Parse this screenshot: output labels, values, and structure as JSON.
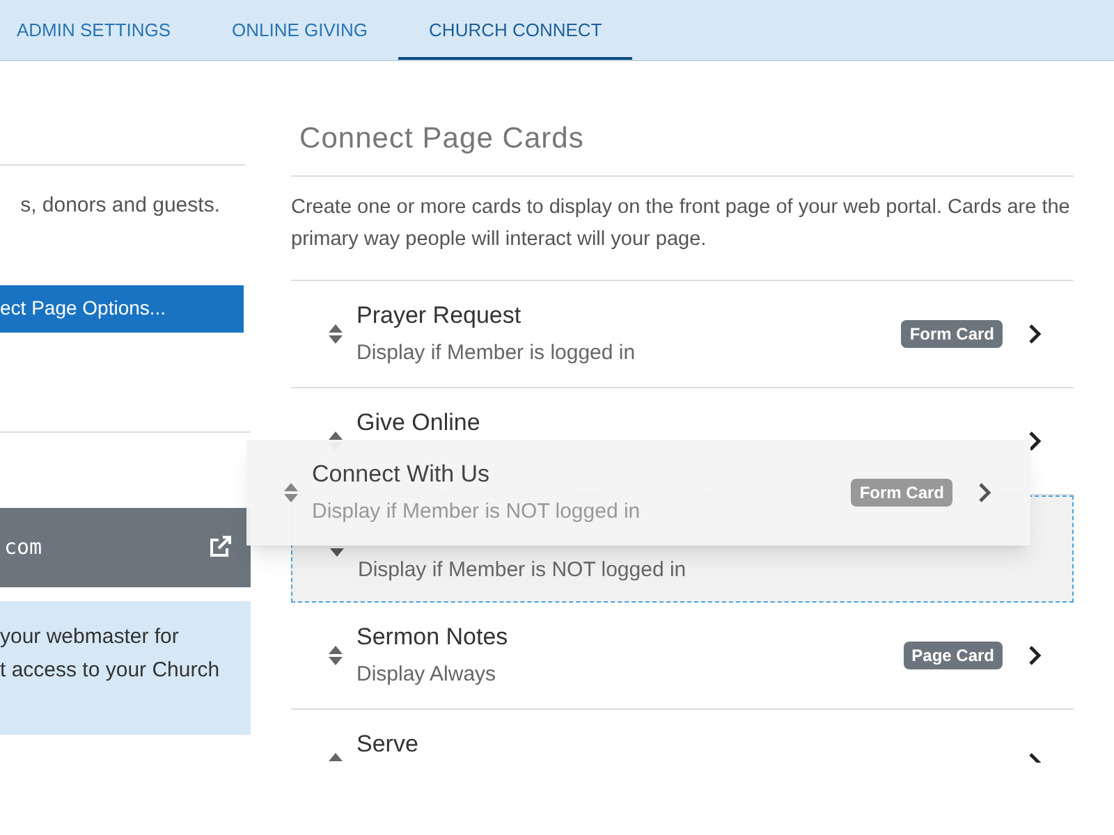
{
  "tabs": [
    {
      "label": "ADMIN SETTINGS",
      "selected": false
    },
    {
      "label": "ONLINE GIVING",
      "selected": false
    },
    {
      "label": "CHURCH CONNECT",
      "selected": true
    }
  ],
  "left_panel": {
    "intro": "s, donors and guests.",
    "options_button": "ect Page Options...",
    "url_bar": {
      "text": "com"
    },
    "note_lines": [
      "your webmaster for",
      "t access to your Church"
    ]
  },
  "cards_panel": {
    "title": "Connect Page Cards",
    "description": "Create one or more cards to display on the front page of your web portal. Cards are the primary way people will interact will your page.",
    "rows": [
      {
        "kind": "card",
        "title": "Prayer Request",
        "subtitle": "Display if Member is logged in",
        "badge": "Form Card"
      },
      {
        "kind": "card",
        "title": "Give Online"
      },
      {
        "kind": "placeholder",
        "subtitle": "Display if Member is NOT logged in"
      },
      {
        "kind": "card",
        "title": "Sermon Notes",
        "subtitle": "Display Always",
        "badge": "Page Card"
      },
      {
        "kind": "card",
        "title": "Serve"
      }
    ],
    "drag_ghost": {
      "title": "Connect With Us",
      "subtitle": "Display if Member is NOT logged in",
      "badge": "Form Card"
    }
  }
}
